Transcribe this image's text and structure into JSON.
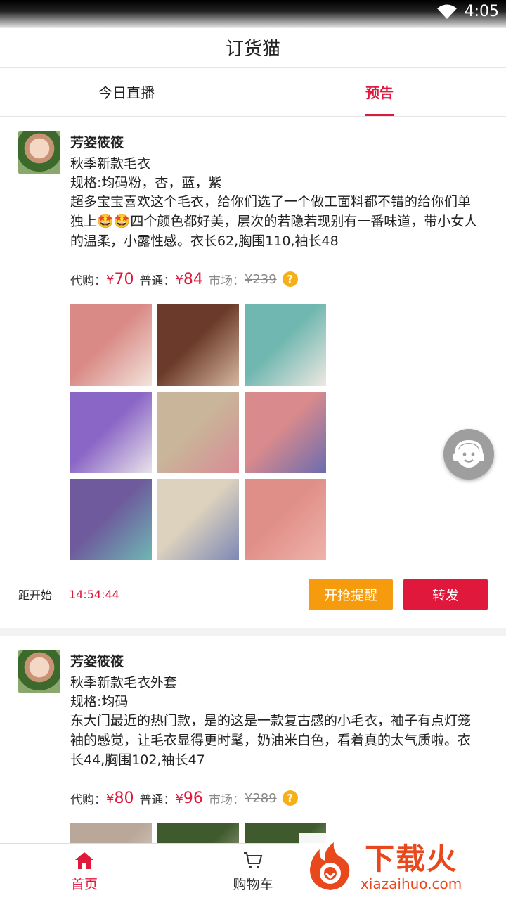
{
  "status_bar": {
    "time": "4:05"
  },
  "app": {
    "title": "订货猫"
  },
  "tabs": [
    {
      "label": "今日直播",
      "active": false
    },
    {
      "label": "预告",
      "active": true
    }
  ],
  "posts": [
    {
      "seller": "芳姿筱筱",
      "title": "秋季新款毛衣",
      "spec": "规格:均码粉，杏，蓝，紫",
      "description": "超多宝宝喜欢这个毛衣，给你们选了一个做工面料都不错的给你们单独上🤩🤩四个颜色都好美，层次的若隐若现别有一番味道，带小女人的温柔，小露性感。衣长62,胸围110,袖长48",
      "labels": {
        "dai": "代购：",
        "pu": "普通：",
        "shi": "市场："
      },
      "price_daigou": "70",
      "price_normal": "84",
      "price_market": "¥239",
      "yen": "¥",
      "countdown_label": "距开始",
      "countdown": "14:54:44",
      "remind_label": "开抢提醒",
      "share_label": "转发",
      "images": [
        {
          "c1": "#d98a86",
          "c2": "#f3e4dc"
        },
        {
          "c1": "#6b3a2a",
          "c2": "#d6b7a0"
        },
        {
          "c1": "#6fb7b0",
          "c2": "#efe8e2"
        },
        {
          "c1": "#8a66c6",
          "c2": "#e9e3ea"
        },
        {
          "c1": "#c9b59a",
          "c2": "#d88c94"
        },
        {
          "c1": "#d98a8c",
          "c2": "#6b6cb0"
        },
        {
          "c1": "#6e5a9c",
          "c2": "#6fb7b4"
        },
        {
          "c1": "#dcd2bd",
          "c2": "#7d88b6"
        },
        {
          "c1": "#e08f88",
          "c2": "#efb3ac"
        }
      ]
    },
    {
      "seller": "芳姿筱筱",
      "title": "秋季新款毛衣外套",
      "spec": "规格:均码",
      "description": "东大门最近的热门款，是的这是一款复古感的小毛衣，袖子有点灯笼袖的感觉，让毛衣显得更时髦，奶油米白色，看着真的太气质啦。衣长44,胸围102,袖长47",
      "labels": {
        "dai": "代购：",
        "pu": "普通：",
        "shi": "市场："
      },
      "price_daigou": "80",
      "price_normal": "96",
      "price_market": "¥289",
      "yen": "¥",
      "images": [
        {
          "c1": "#b9a89a",
          "c2": "#e8e2dc"
        },
        {
          "c1": "#3f5a2c",
          "c2": "#d8d2c8"
        },
        {
          "c1": "#3f5a2c",
          "c2": "#e7e3dc"
        }
      ]
    }
  ],
  "bottom_nav": [
    {
      "label": "首页",
      "icon": "home-icon",
      "active": true
    },
    {
      "label": "购物车",
      "icon": "cart-icon",
      "active": false
    }
  ],
  "watermark": {
    "brand": "下载火",
    "domain": "xiazaihuo.com"
  },
  "colors": {
    "accent": "#e0183c",
    "orange": "#f59b0d"
  }
}
